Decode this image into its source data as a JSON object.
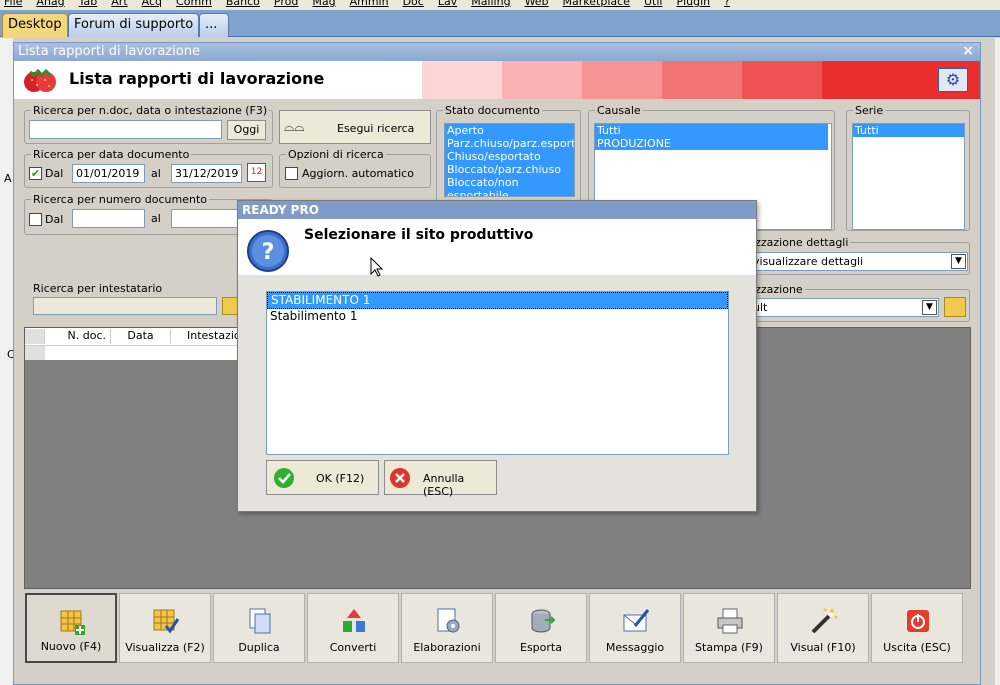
{
  "menu": [
    "File",
    "Anag",
    "Tab",
    "Art",
    "Acq",
    "Comm",
    "Banco",
    "Prod",
    "Mag",
    "Ammin",
    "Doc",
    "Lav",
    "Mailing",
    "Web",
    "Marketplace",
    "Util",
    "Plugin",
    "?"
  ],
  "tabs": [
    "Desktop",
    "Forum di supporto",
    "..."
  ],
  "window": {
    "title": "Lista rapporti di lavorazione",
    "close": "×",
    "header_title": "Lista rapporti di lavorazione"
  },
  "search": {
    "doc_label": "Ricerca per n.doc, data o intestazione (F3)",
    "doc_value": "",
    "today_button": "Oggi",
    "run_button": "Esegui ricerca",
    "date_label": "Ricerca per data documento",
    "date_from_check": "Dal",
    "date_from": "01/01/2019",
    "date_to_label": "al",
    "date_to": "31/12/2019",
    "number_label": "Ricerca per numero documento",
    "number_from_check": "Dal",
    "number_to_label": "al",
    "options_label": "Opzioni di ricerca",
    "auto_update": "Aggiorn. automatico",
    "holder_label": "Ricerca per intestatario",
    "holder_value": ""
  },
  "status": {
    "label": "Stato documento",
    "items": [
      "Aperto",
      "Parz.chiuso/parz.esportato",
      "Chiuso/esportato",
      "Bloccato/parz.chiuso",
      "Bloccato/non esportabile"
    ]
  },
  "causale": {
    "label": "Causale",
    "items": [
      "Tutti",
      "PRODUZIONE"
    ]
  },
  "serie": {
    "label": "Serie",
    "items": [
      "Tutti"
    ]
  },
  "details": {
    "label": "lizzazione dettagli",
    "value": "visualizzare dettagli"
  },
  "view": {
    "label": "lizzazione",
    "value": "ult"
  },
  "table": {
    "columns": [
      "N. doc.",
      "Data",
      "Intestazio"
    ]
  },
  "toolbar": [
    "Nuovo (F4)",
    "Visualizza (F2)",
    "Duplica",
    "Converti",
    "Elaborazioni",
    "Esporta",
    "Messaggio",
    "Stampa (F9)",
    "Visual (F10)",
    "Uscita (ESC)"
  ],
  "dialog": {
    "title": "READY PRO",
    "message": "Selezionare il sito produttivo",
    "items": [
      "STABILIMENTO 1",
      "Stabilimento 1"
    ],
    "ok": "OK (F12)",
    "cancel": "Annulla (ESC)"
  },
  "side_letters": {
    "a": "A",
    "c": "C"
  },
  "colors": {
    "accent": "#3399ff",
    "header_gradient": [
      "#fbd6d6",
      "#f6a5a5",
      "#f17373",
      "#ec2a2a"
    ]
  }
}
